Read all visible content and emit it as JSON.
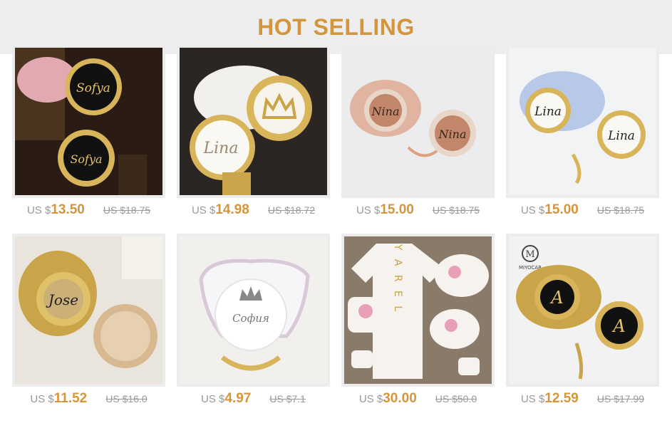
{
  "header": {
    "title": "HOT SELLING"
  },
  "colors": {
    "accent": "#d4963c",
    "muted": "#999999",
    "header_bg": "#eeeeee"
  },
  "products": [
    {
      "image_text": [
        "Sofya",
        "Sofya"
      ],
      "currency": "US $",
      "price": "13.50",
      "original_price": "US $18.75"
    },
    {
      "image_text": [
        "Lina"
      ],
      "currency": "US $",
      "price": "14.98",
      "original_price": "US $18.72"
    },
    {
      "image_text": [
        "Nina",
        "Nina"
      ],
      "currency": "US $",
      "price": "15.00",
      "original_price": "US $18.75"
    },
    {
      "image_text": [
        "Lina",
        "Lina"
      ],
      "currency": "US $",
      "price": "15.00",
      "original_price": "US $18.75"
    },
    {
      "image_text": [
        "Jose"
      ],
      "currency": "US $",
      "price": "11.52",
      "original_price": "US $16.0"
    },
    {
      "image_text": [
        "Софuя"
      ],
      "currency": "US $",
      "price": "4.97",
      "original_price": "US $7.1"
    },
    {
      "image_text": [
        "Y A R E L"
      ],
      "currency": "US $",
      "price": "30.00",
      "original_price": "US $50.0"
    },
    {
      "image_text": [
        "MIYOCAR",
        "A",
        "A"
      ],
      "currency": "US $",
      "price": "12.59",
      "original_price": "US $17.99"
    }
  ]
}
